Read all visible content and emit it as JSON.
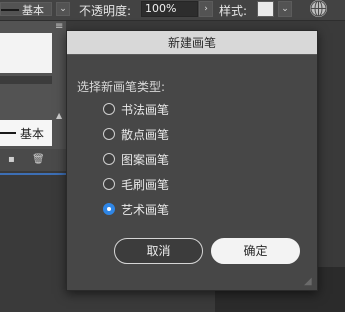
{
  "toolbar": {
    "stroke_profile_label": "基本",
    "opacity_label": "不透明度:",
    "opacity_value": "100%",
    "style_label": "样式:",
    "dropdown_arrow": "⌄",
    "next_arrow": "›"
  },
  "brush_panel": {
    "basic_brush_label": "基本"
  },
  "dialog": {
    "title": "新建画笔",
    "prompt": "选择新画笔类型:",
    "options": [
      {
        "label": "书法画笔",
        "checked": false
      },
      {
        "label": "散点画笔",
        "checked": false
      },
      {
        "label": "图案画笔",
        "checked": false
      },
      {
        "label": "毛刷画笔",
        "checked": false
      },
      {
        "label": "艺术画笔",
        "checked": true
      }
    ],
    "cancel_label": "取消",
    "ok_label": "确定"
  },
  "colors": {
    "accent": "#2f86e6",
    "dialog_bg": "#474747",
    "title_bar": "#d8d8d8"
  },
  "icons": [
    "chevron-down-icon",
    "chevron-right-icon",
    "globe-icon",
    "panel-menu-icon",
    "new-brush-icon",
    "trash-icon"
  ]
}
